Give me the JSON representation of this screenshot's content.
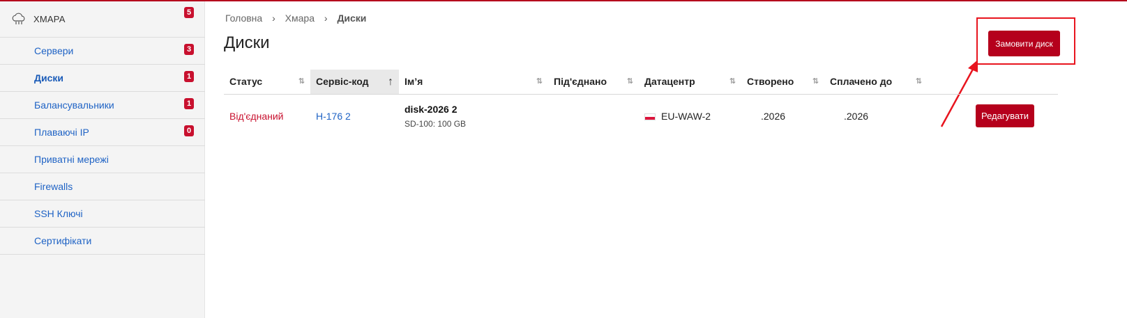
{
  "sidebar": {
    "header": {
      "title": "ХМАРА",
      "badge": "5",
      "icon": "cloud-icon"
    },
    "items": [
      {
        "label": "Сервери",
        "badge": "3"
      },
      {
        "label": "Диски",
        "badge": "1",
        "active": true
      },
      {
        "label": "Балансувальники",
        "badge": "1"
      },
      {
        "label": "Плаваючі IP",
        "badge": "0"
      },
      {
        "label": "Приватні мережі"
      },
      {
        "label": "Firewalls"
      },
      {
        "label": "SSH Ключі"
      },
      {
        "label": "Сертифікати"
      }
    ]
  },
  "breadcrumb": {
    "home": "Головна",
    "section": "Хмара",
    "current": "Диски",
    "separator": "›"
  },
  "page": {
    "title": "Диски",
    "order_button": "Замовити диск"
  },
  "table": {
    "headers": {
      "status": "Статус",
      "service_code": "Сервіс-код",
      "name": "Ім’я",
      "attached": "Під'єднано",
      "datacenter": "Датацентр",
      "created": "Створено",
      "paid_until": "Сплачено до"
    },
    "sort_icon": "⇅",
    "sorted_icon": "↑",
    "rows": [
      {
        "status": "Від'єднаний",
        "service_code": "H-176   2",
        "name": "disk-2026        2",
        "spec": "SD-100: 100 GB",
        "attached": "",
        "datacenter": "EU-WAW-2",
        "created": ".2026",
        "paid_until": ".2026",
        "edit_label": "Редагувати"
      }
    ]
  },
  "colors": {
    "accent": "#b5001c",
    "link": "#1f63c5",
    "annotation": "#e8141e"
  }
}
